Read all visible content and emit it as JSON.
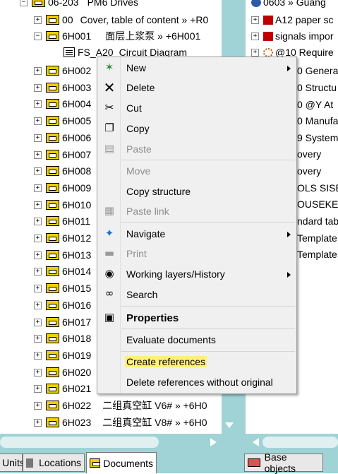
{
  "left_tree": {
    "root": {
      "code": "06-203",
      "name": "PM6 Drives"
    },
    "items": [
      {
        "code": "00",
        "desc": "Cover, table of content  »  +R0"
      },
      {
        "code": "6H001",
        "desc": "面层上浆泵  »  +6H001"
      },
      {
        "code": "FS_A20",
        "desc": "Circuit Diagram"
      },
      {
        "code": "6H002"
      },
      {
        "code": "6H003"
      },
      {
        "code": "6H004"
      },
      {
        "code": "6H005"
      },
      {
        "code": "6H006"
      },
      {
        "code": "6H007"
      },
      {
        "code": "6H008"
      },
      {
        "code": "6H009"
      },
      {
        "code": "6H010"
      },
      {
        "code": "6H011"
      },
      {
        "code": "6H012"
      },
      {
        "code": "6H013"
      },
      {
        "code": "6H014"
      },
      {
        "code": "6H015"
      },
      {
        "code": "6H016"
      },
      {
        "code": "6H017"
      },
      {
        "code": "6H018"
      },
      {
        "code": "6H019"
      },
      {
        "code": "6H020"
      },
      {
        "code": "6H021"
      },
      {
        "code": "6H022",
        "desc": "二组真空缸 V6#  »  +6H0"
      },
      {
        "code": "6H023",
        "desc": "二组真空缸 V8#  »  +6H0"
      }
    ]
  },
  "right_tree": {
    "items": [
      "0603  »  Guang",
      "A12  paper sc",
      "signals impor",
      "@10  Require",
      "0  Genera",
      "0  Structu",
      "0  @Y  At",
      "0  Manufa",
      "9  System",
      "overy",
      "overy",
      "OLS  SISE",
      "OUSEKEEP",
      "ndard tabl",
      "Template",
      "Template"
    ]
  },
  "menu": {
    "new": "New",
    "delete": "Delete",
    "cut": "Cut",
    "copy": "Copy",
    "paste": "Paste",
    "move": "Move",
    "copy_structure": "Copy structure",
    "paste_link": "Paste link",
    "navigate": "Navigate",
    "print": "Print",
    "working_layers": "Working layers/History",
    "search": "Search",
    "properties": "Properties",
    "evaluate": "Evaluate documents",
    "create_refs": "Create references",
    "delete_refs": "Delete references without original"
  },
  "tabs": {
    "units": "Units",
    "locations": "Locations",
    "documents": "Documents",
    "base_objects": "Base objects"
  },
  "colors": {
    "highlight": "#fff176",
    "teal_bg": "#9fd3d6",
    "folder": "#f0d000"
  }
}
